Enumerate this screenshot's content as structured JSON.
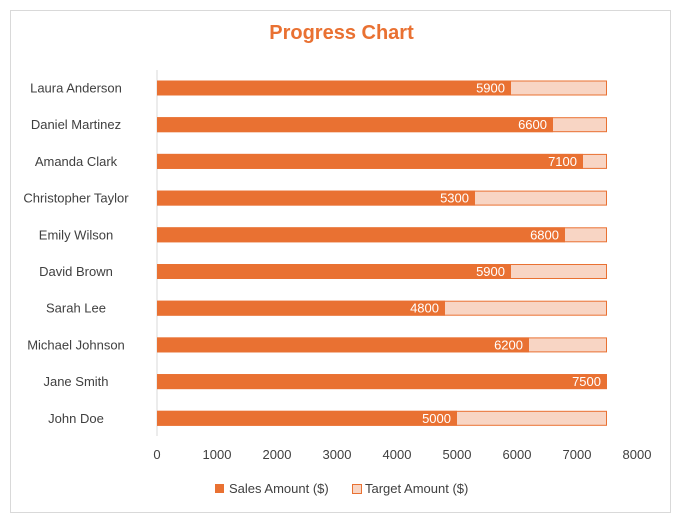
{
  "chart_data": {
    "type": "bar",
    "orientation": "horizontal",
    "title": "Progress Chart",
    "categories": [
      "Laura Anderson",
      "Daniel Martinez",
      "Amanda Clark",
      "Christopher Taylor",
      "Emily Wilson",
      "David Brown",
      "Sarah Lee",
      "Michael Johnson",
      "Jane Smith",
      "John Doe"
    ],
    "series": [
      {
        "name": "Sales Amount ($)",
        "color": "#E97132",
        "values": [
          5900,
          6600,
          7100,
          5300,
          6800,
          5900,
          4800,
          6200,
          7500,
          5000
        ]
      },
      {
        "name": "Target Amount ($)",
        "color": "#F8D5C4",
        "border": "#E97132",
        "values": [
          7500,
          7500,
          7500,
          7500,
          7500,
          7500,
          7500,
          7500,
          7500,
          7500
        ]
      }
    ],
    "xlim": [
      0,
      8000
    ],
    "xticks": [
      "0",
      "1000",
      "2000",
      "3000",
      "4000",
      "5000",
      "6000",
      "7000",
      "8000"
    ],
    "xlabel": "",
    "ylabel": "",
    "grid": false,
    "data_labels": "sales values shown inside end of sales bar",
    "legend": "bottom"
  }
}
